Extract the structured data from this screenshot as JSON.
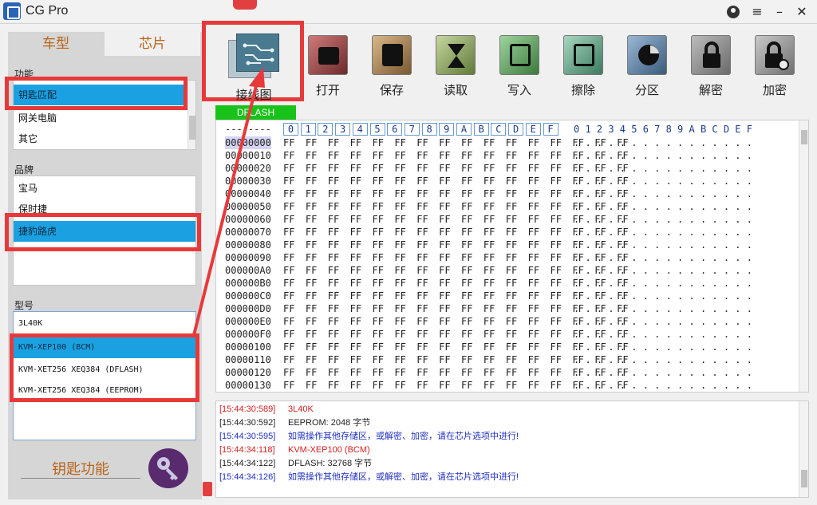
{
  "window": {
    "title": "CG Pro"
  },
  "left_panel": {
    "tabs": [
      "车型",
      "芯片"
    ],
    "function_label": "功能",
    "functions": [
      "钥匙匹配",
      "网关电脑",
      "其它"
    ],
    "brand_label": "品牌",
    "brands": [
      "宝马",
      "保时捷",
      "捷豹路虎"
    ],
    "model_label": "型号",
    "model_value": "3L40K",
    "models": [
      "KVM-XEP100 (BCM)",
      "KVM-XET256 XEQ384 (DFLASH)",
      "KVM-XET256 XEQ384 (EEPROM)"
    ],
    "key_function": "钥匙功能"
  },
  "toolbar": {
    "wiring": "接线图",
    "open": "打开",
    "save": "保存",
    "read": "读取",
    "write": "写入",
    "erase": "擦除",
    "partition": "分区",
    "decrypt": "解密",
    "encrypt": "加密"
  },
  "memory_tag": "DFLASH",
  "hex": {
    "dash": "--------",
    "columns": [
      "0",
      "1",
      "2",
      "3",
      "4",
      "5",
      "6",
      "7",
      "8",
      "9",
      "A",
      "B",
      "C",
      "D",
      "E",
      "F"
    ],
    "ascii_header": "0 1 2 3 4 5 6 7 8 9 A B C D E F",
    "addresses": [
      "00000000",
      "00000010",
      "00000020",
      "00000030",
      "00000040",
      "00000050",
      "00000060",
      "00000070",
      "00000080",
      "00000090",
      "000000A0",
      "000000B0",
      "000000C0",
      "000000D0",
      "000000E0",
      "000000F0",
      "00000100",
      "00000110",
      "00000120",
      "00000130"
    ],
    "row_bytes": "FF FF FF FF FF FF FF FF FF FF FF FF FF FF FF FF",
    "row_ascii": ". . . . . . . . . . . . . . . ."
  },
  "log": [
    {
      "time": "[15:44:30:589]",
      "text": "3L40K",
      "color": "red"
    },
    {
      "time": "[15:44:30:592]",
      "text": "EEPROM:  2048  字节",
      "color": "black"
    },
    {
      "time": "[15:44:30:595]",
      "text": "如需操作其他存储区，或解密、加密，请在芯片选项中进行!",
      "color": "blue"
    },
    {
      "time": "[15:44:34:118]",
      "text": "KVM-XEP100  (BCM)",
      "color": "red"
    },
    {
      "time": "[15:44:34:122]",
      "text": "DFLASH:  32768  字节",
      "color": "black"
    },
    {
      "time": "[15:44:34:126]",
      "text": "如需操作其他存储区，或解密、加密，请在芯片选项中进行!",
      "color": "blue"
    }
  ]
}
